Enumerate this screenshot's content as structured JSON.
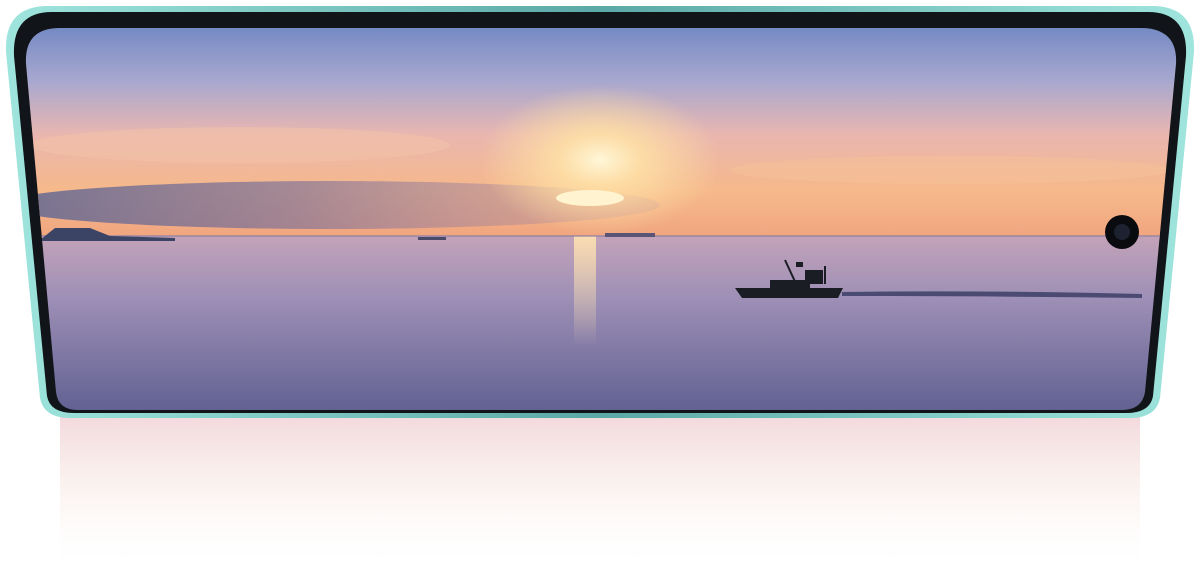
{
  "image": {
    "subject": "phone-display-sunset-seascape",
    "elements": [
      "phone-frame",
      "screen",
      "sky",
      "sun-glow",
      "sea",
      "boat",
      "front-camera",
      "reflection"
    ]
  },
  "colors": {
    "frame_edge": "#7fd6d0",
    "frame_body": "#111418",
    "sky_top": "#6e86c2",
    "sky_mid": "#e9b6b0",
    "sky_warm": "#f6b98a",
    "sky_horizon": "#f0a47f",
    "cloud_band": "#6f6f9a",
    "sea_top": "#b79cb8",
    "sea_mid": "#8f88b2",
    "sea_bottom": "#5f5f90",
    "sun": "#fff1c4",
    "boat": "#1a1d24"
  }
}
